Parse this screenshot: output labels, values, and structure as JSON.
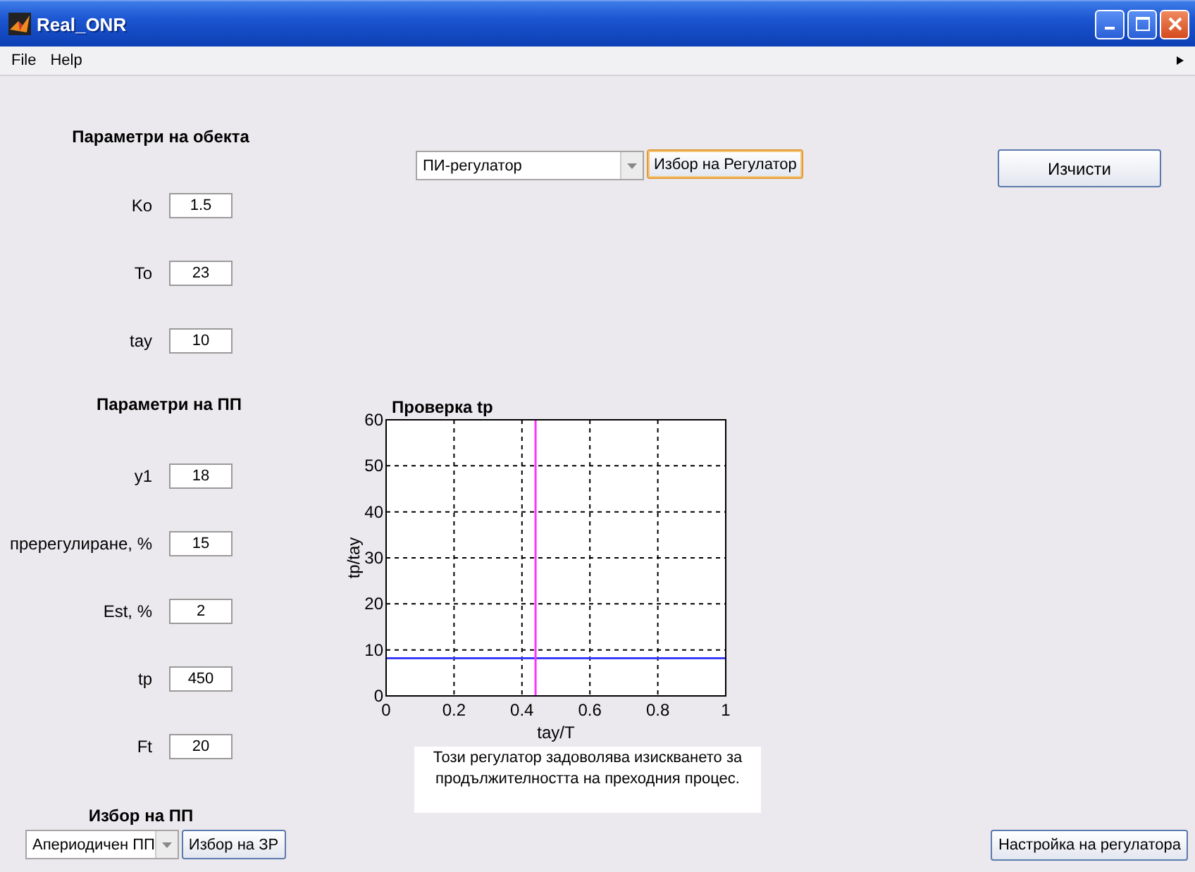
{
  "window": {
    "title": "Real_ONR"
  },
  "menu": [
    "File",
    "Help"
  ],
  "object_params": {
    "title": "Параметри на обекта",
    "fields": [
      {
        "label": "Ko",
        "value": "1.5"
      },
      {
        "label": "To",
        "value": "23"
      },
      {
        "label": "tay",
        "value": "10"
      }
    ]
  },
  "process_params": {
    "title": "Параметри на ПП",
    "fields": [
      {
        "label": "y1",
        "value": "18"
      },
      {
        "label": "пререгулиране, %",
        "value": "15"
      },
      {
        "label": "Est, %",
        "value": "2"
      },
      {
        "label": "tp",
        "value": "450"
      },
      {
        "label": "Ft",
        "value": "20"
      }
    ]
  },
  "process_choice": {
    "title": "Избор на ПП",
    "dropdown": "Апериодичен ПП",
    "button": "Избор на ЗР"
  },
  "regulator": {
    "dropdown": "ПИ-регулатор",
    "button": "Избор на Регулатор"
  },
  "clear_button": "Изчисти",
  "chart": {
    "chart_data": {
      "type": "line",
      "title": "Проверка tp",
      "xlabel": "tay/T",
      "ylabel": "tp/tay",
      "grid": true,
      "xlim": [
        0,
        1
      ],
      "ylim": [
        0,
        60
      ],
      "xticks": [
        0,
        0.2,
        0.4,
        0.6,
        0.8,
        1
      ],
      "yticks": [
        0,
        10,
        20,
        30,
        40,
        50,
        60
      ],
      "series": [
        {
          "color": "#3b3bff",
          "x": [
            0,
            1
          ],
          "values": [
            8.2,
            8.2
          ]
        },
        {
          "color": "#ff33ff",
          "x": [
            0.44,
            0.44
          ],
          "values": [
            0,
            60
          ]
        }
      ]
    }
  },
  "message": "Този регулатор задоволява изискването за продължителността на преходния процес.",
  "tune_button": "Настройка на регулатора"
}
